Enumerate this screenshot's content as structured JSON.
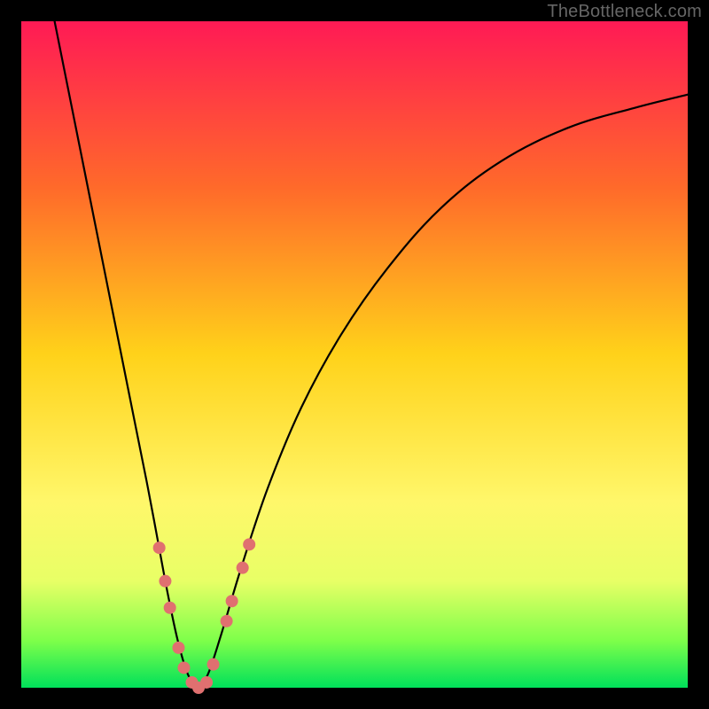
{
  "watermark": "TheBottleneck.com",
  "chart_data": {
    "type": "line",
    "title": "",
    "xlabel": "",
    "ylabel": "",
    "xlim": [
      0,
      100
    ],
    "ylim": [
      0,
      100
    ],
    "gradient_stops": [
      {
        "offset": 0,
        "color": "#ff1a55"
      },
      {
        "offset": 25,
        "color": "#ff6a2a"
      },
      {
        "offset": 50,
        "color": "#ffd21a"
      },
      {
        "offset": 72,
        "color": "#fff76a"
      },
      {
        "offset": 84,
        "color": "#e8ff66"
      },
      {
        "offset": 93,
        "color": "#7dff4a"
      },
      {
        "offset": 100,
        "color": "#00e05a"
      }
    ],
    "series": [
      {
        "name": "left-branch",
        "stroke": "#000000",
        "stroke_width": 2.2,
        "points": [
          {
            "x": 5,
            "y": 100
          },
          {
            "x": 7,
            "y": 90
          },
          {
            "x": 9,
            "y": 80
          },
          {
            "x": 11,
            "y": 70
          },
          {
            "x": 13,
            "y": 60
          },
          {
            "x": 15,
            "y": 50
          },
          {
            "x": 17,
            "y": 40
          },
          {
            "x": 19,
            "y": 30
          },
          {
            "x": 20.5,
            "y": 22
          },
          {
            "x": 22,
            "y": 14
          },
          {
            "x": 23.5,
            "y": 7
          },
          {
            "x": 25,
            "y": 2
          },
          {
            "x": 26.5,
            "y": 0
          }
        ]
      },
      {
        "name": "right-branch",
        "stroke": "#000000",
        "stroke_width": 2.2,
        "points": [
          {
            "x": 26.5,
            "y": 0
          },
          {
            "x": 28,
            "y": 2
          },
          {
            "x": 30,
            "y": 8
          },
          {
            "x": 33,
            "y": 18
          },
          {
            "x": 37,
            "y": 30
          },
          {
            "x": 42,
            "y": 42
          },
          {
            "x": 48,
            "y": 53
          },
          {
            "x": 55,
            "y": 63
          },
          {
            "x": 63,
            "y": 72
          },
          {
            "x": 72,
            "y": 79
          },
          {
            "x": 82,
            "y": 84
          },
          {
            "x": 92,
            "y": 87
          },
          {
            "x": 100,
            "y": 89
          }
        ]
      }
    ],
    "marker_points": {
      "color": "#e07070",
      "radius": 7,
      "points": [
        {
          "x": 20.7,
          "y": 21
        },
        {
          "x": 21.6,
          "y": 16
        },
        {
          "x": 22.3,
          "y": 12
        },
        {
          "x": 23.6,
          "y": 6
        },
        {
          "x": 24.4,
          "y": 3
        },
        {
          "x": 25.6,
          "y": 0.8
        },
        {
          "x": 26.6,
          "y": 0
        },
        {
          "x": 27.8,
          "y": 0.8
        },
        {
          "x": 28.8,
          "y": 3.5
        },
        {
          "x": 30.8,
          "y": 10
        },
        {
          "x": 31.6,
          "y": 13
        },
        {
          "x": 33.2,
          "y": 18
        },
        {
          "x": 34.2,
          "y": 21.5
        }
      ]
    }
  }
}
